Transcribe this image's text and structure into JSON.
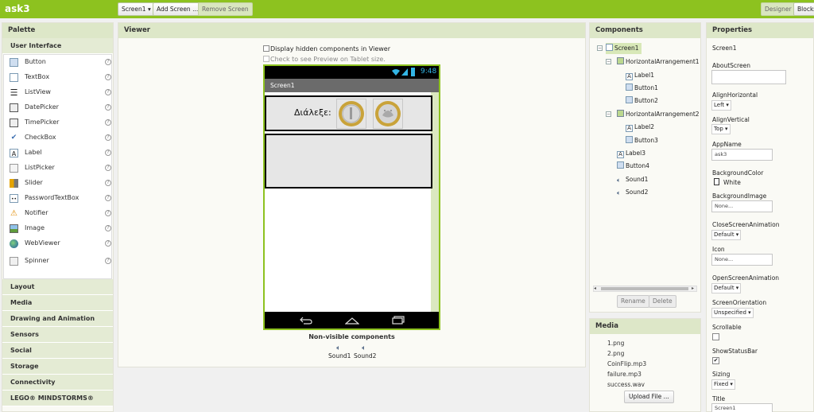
{
  "app": {
    "title": "ask3",
    "screen_dropdown": "Screen1 ▾",
    "add_screen": "Add Screen ...",
    "remove_screen": "Remove Screen",
    "designer": "Designer",
    "blocks": "Blocks"
  },
  "palette": {
    "title": "Palette",
    "user_interface": "User Interface",
    "items": [
      {
        "label": "Button",
        "icon": "button-icon"
      },
      {
        "label": "TextBox",
        "icon": "textbox-icon"
      },
      {
        "label": "ListView",
        "icon": "listview-icon"
      },
      {
        "label": "DatePicker",
        "icon": "datepicker-icon"
      },
      {
        "label": "TimePicker",
        "icon": "timepicker-icon"
      },
      {
        "label": "CheckBox",
        "icon": "checkbox-icon"
      },
      {
        "label": "Label",
        "icon": "label-icon"
      },
      {
        "label": "ListPicker",
        "icon": "listpicker-icon"
      },
      {
        "label": "Slider",
        "icon": "slider-icon"
      },
      {
        "label": "PasswordTextBox",
        "icon": "password-icon"
      },
      {
        "label": "Notifier",
        "icon": "notifier-icon"
      },
      {
        "label": "Image",
        "icon": "image-icon"
      },
      {
        "label": "WebViewer",
        "icon": "webviewer-icon"
      },
      {
        "label": "Spinner",
        "icon": "spinner-icon"
      }
    ],
    "categories": [
      "Layout",
      "Media",
      "Drawing and Animation",
      "Sensors",
      "Social",
      "Storage",
      "Connectivity",
      "LEGO® MINDSTORMS®"
    ],
    "help_glyph": "?"
  },
  "viewer": {
    "title": "Viewer",
    "display_hidden": "Display hidden components in Viewer",
    "tablet_preview": "Check to see Preview on Tablet size.",
    "phone": {
      "time": "9:48",
      "screen_title": "Screen1",
      "label_text": "Διάλεξε:"
    },
    "nonvisible_title": "Non-visible components",
    "nonvisible": [
      "Sound1",
      "Sound2"
    ]
  },
  "components": {
    "title": "Components",
    "tree": [
      {
        "label": "Screen1",
        "type": "screen"
      },
      {
        "label": "HorizontalArrangement1",
        "type": "harr"
      },
      {
        "label": "Label1",
        "type": "label"
      },
      {
        "label": "Button1",
        "type": "button"
      },
      {
        "label": "Button2",
        "type": "button"
      },
      {
        "label": "HorizontalArrangement2",
        "type": "harr"
      },
      {
        "label": "Label2",
        "type": "label"
      },
      {
        "label": "Button3",
        "type": "button"
      },
      {
        "label": "Label3",
        "type": "label"
      },
      {
        "label": "Button4",
        "type": "button"
      },
      {
        "label": "Sound1",
        "type": "sound"
      },
      {
        "label": "Sound2",
        "type": "sound"
      }
    ],
    "rename": "Rename",
    "delete": "Delete"
  },
  "media": {
    "title": "Media",
    "files": [
      "1.png",
      "2.png",
      "CoinFlip.mp3",
      "failure.mp3",
      "success.wav"
    ],
    "upload": "Upload File ..."
  },
  "properties": {
    "title": "Properties",
    "component": "Screen1",
    "about_screen": "AboutScreen",
    "align_horizontal": "AlignHorizontal",
    "align_horizontal_value": "Left ▾",
    "align_vertical": "AlignVertical",
    "align_vertical_value": "Top ▾",
    "app_name": "AppName",
    "app_name_value": "ask3",
    "background_color": "BackgroundColor",
    "background_color_value": "White",
    "background_image": "BackgroundImage",
    "background_image_value": "None...",
    "close_anim": "CloseScreenAnimation",
    "close_anim_value": "Default ▾",
    "icon": "Icon",
    "icon_value": "None...",
    "open_anim": "OpenScreenAnimation",
    "open_anim_value": "Default ▾",
    "orientation": "ScreenOrientation",
    "orientation_value": "Unspecified ▾",
    "scrollable": "Scrollable",
    "show_status_bar": "ShowStatusBar",
    "sizing": "Sizing",
    "sizing_value": "Fixed ▾",
    "title_label": "Title",
    "title_value": "Screen1"
  }
}
